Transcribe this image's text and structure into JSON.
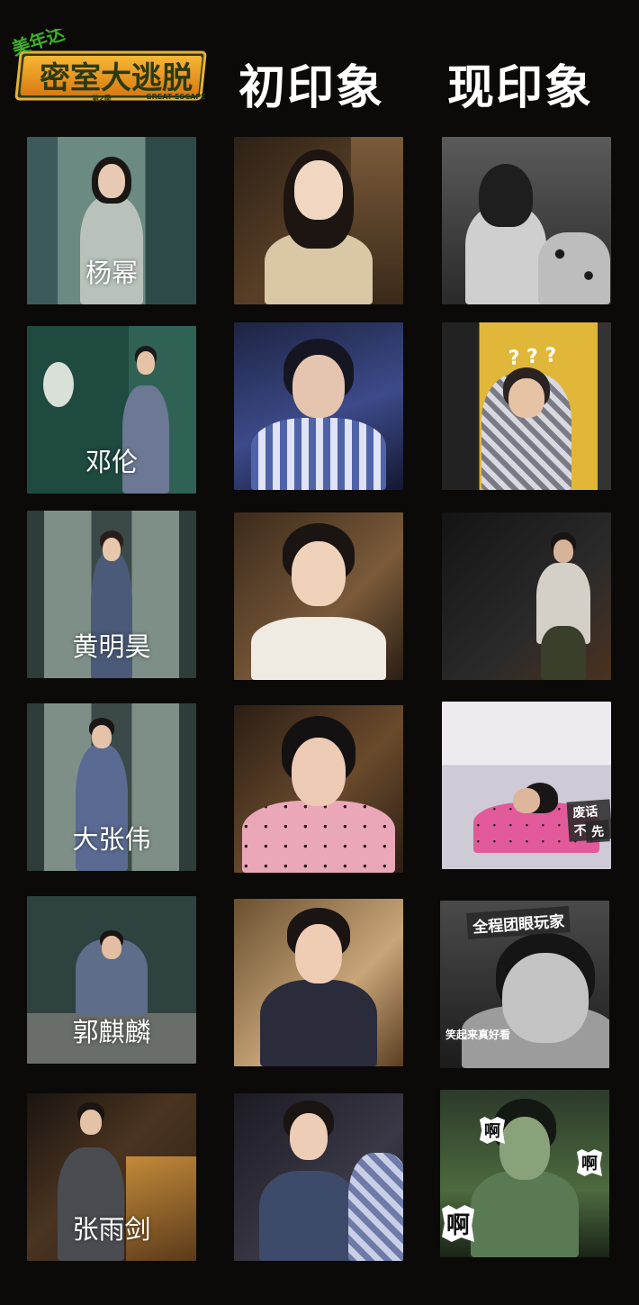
{
  "header": {
    "logo_text": "密室大逃脱",
    "logo_sponsor": "美年达",
    "logo_sub": "GREAT ESCAPE",
    "logo_season": "第2季",
    "col_first": "初印象",
    "col_now": "现印象"
  },
  "rows": [
    {
      "name": "杨幂"
    },
    {
      "name": "邓伦"
    },
    {
      "name": "黄明昊"
    },
    {
      "name": "大张伟"
    },
    {
      "name": "郭麒麟"
    },
    {
      "name": "张雨剑"
    }
  ],
  "captions": {
    "daz_now": "废话不",
    "daz_now2": "先",
    "guo_now_top": "全程团眼玩家",
    "guo_now_bottom": "笑起来真好看",
    "zhang_now_1": "啊",
    "zhang_now_2": "啊",
    "zhang_now_3": "啊",
    "deng_now": "? ? ?"
  }
}
